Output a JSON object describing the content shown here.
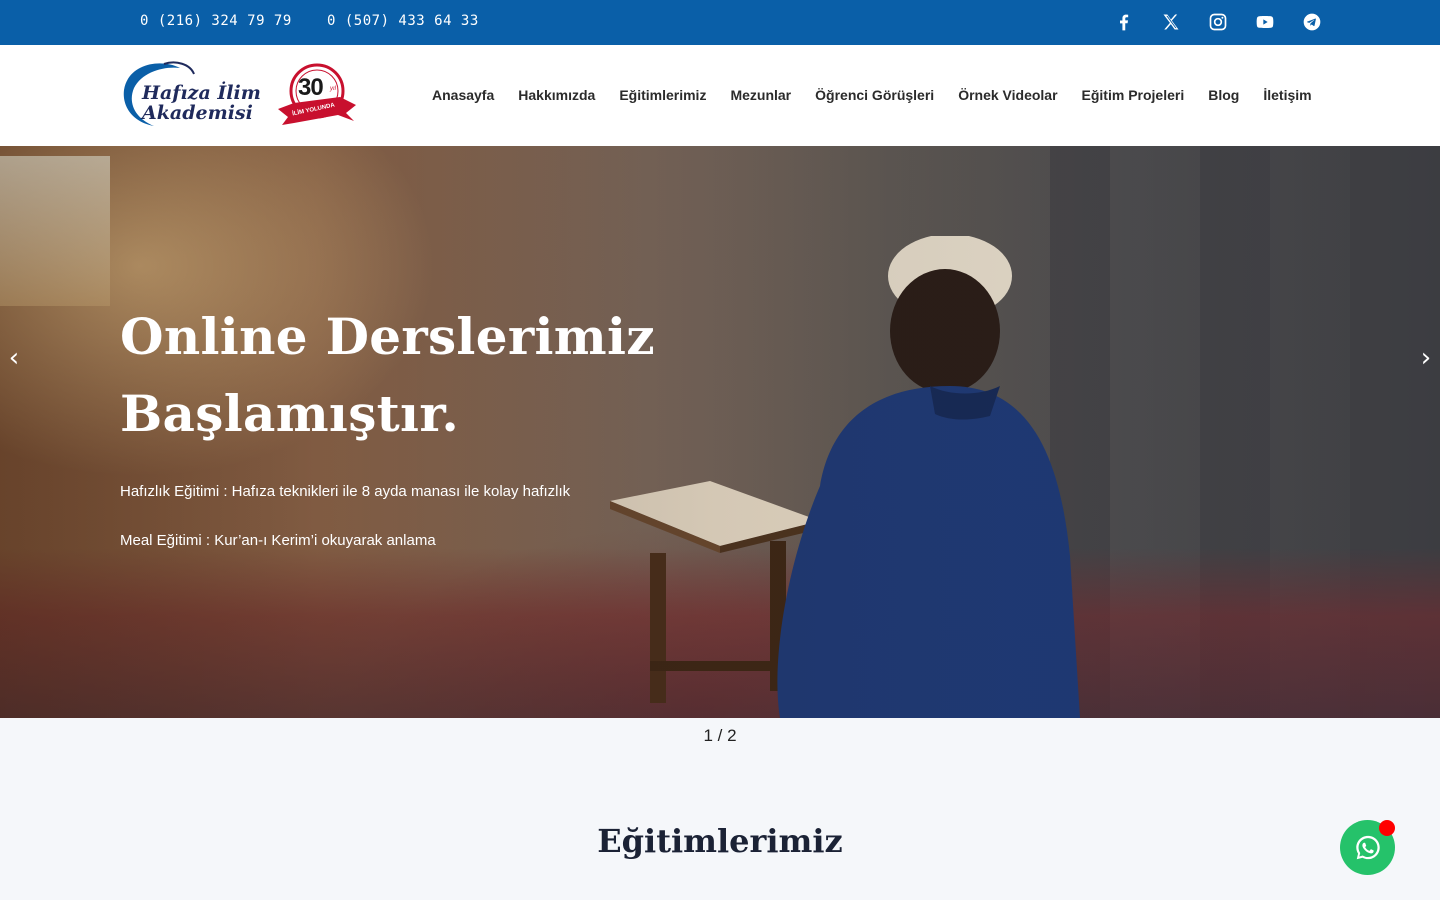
{
  "topbar": {
    "phone1": "0 (216) 324 79 79",
    "phone2": "0 (507) 433 64 33",
    "socials": [
      "facebook-icon",
      "x-icon",
      "instagram-icon",
      "youtube-icon",
      "telegram-icon"
    ]
  },
  "logo": {
    "line1": "Hafıza İlim",
    "line2": "Akademisi"
  },
  "badge": {
    "number": "30",
    "suffix": "yıl",
    "ribbon": "İLİM YOLUNDA"
  },
  "nav": {
    "items": [
      "Anasayfa",
      "Hakkımızda",
      "Eğitimlerimiz",
      "Mezunlar",
      "Öğrenci Görüşleri",
      "Örnek Videolar",
      "Eğitim Projeleri",
      "Blog",
      "İletişim"
    ]
  },
  "hero": {
    "title": "Online Derslerimiz Başlamıştır.",
    "line1": "Hafızlık Eğitimi : Hafıza teknikleri ile 8 ayda manası ile kolay hafızlık",
    "line2": "Meal Eğitimi : Kur’an-ı Kerim’i okuyarak anlama",
    "prev": "‹",
    "next": "›"
  },
  "slider": {
    "pager": "1 / 2"
  },
  "section": {
    "title": "Eğitimlerimiz"
  },
  "colors": {
    "topbar": "#0a5fa8",
    "whatsapp": "#25c26a",
    "badge_red": "#c8102e"
  }
}
